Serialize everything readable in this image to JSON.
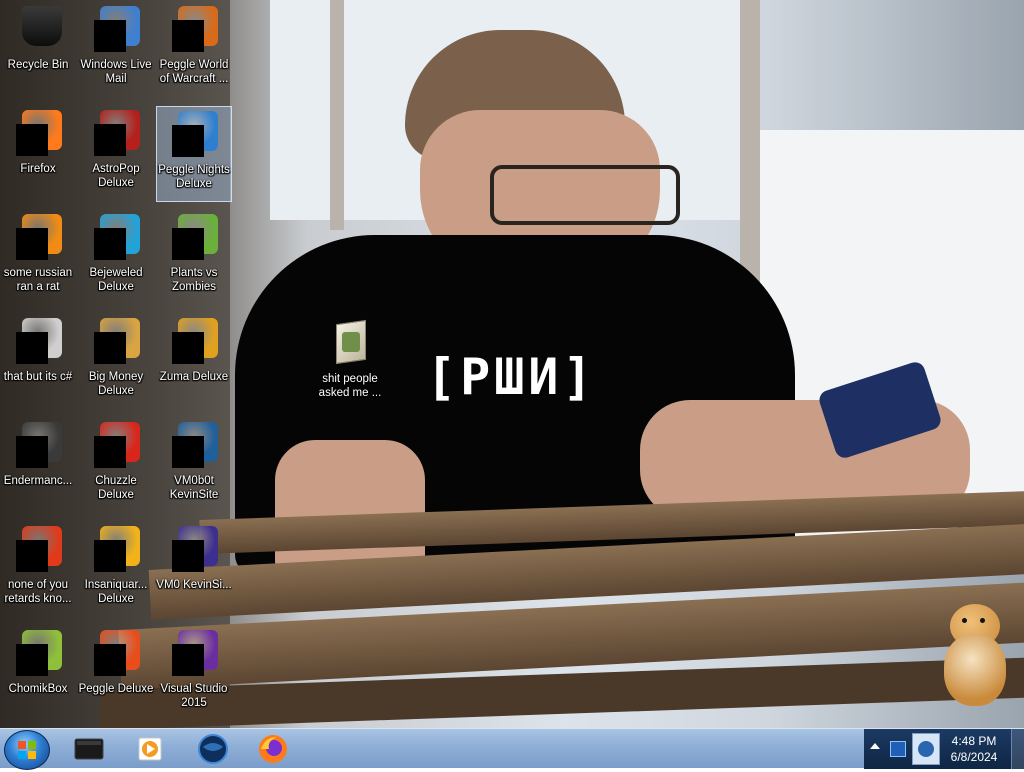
{
  "desktop": {
    "icons": [
      {
        "id": "recycle-bin",
        "label": "Recycle Bin",
        "icon": "recycle-bin-icon",
        "color": "#1b1b1b"
      },
      {
        "id": "windows-live-mail",
        "label": "Windows Live Mail",
        "icon": "mail-icon",
        "color": "#3f7fd0"
      },
      {
        "id": "peggle-world-of-warcraft",
        "label": "Peggle World of Warcraft ...",
        "icon": "peggle-wow-icon",
        "color": "#d76b1a"
      },
      {
        "id": "firefox",
        "label": "Firefox",
        "icon": "firefox-icon",
        "color": "#ff7a1a"
      },
      {
        "id": "astropop-deluxe",
        "label": "AstroPop Deluxe",
        "icon": "astropop-icon",
        "color": "#b4201c"
      },
      {
        "id": "peggle-nights-deluxe",
        "label": "Peggle Nights Deluxe",
        "icon": "peggle-nights-icon",
        "color": "#2e7fcf"
      },
      {
        "id": "some-russian-ran-a-rat",
        "label": "some russian ran a rat",
        "icon": "orange-file-icon",
        "color": "#f08c14"
      },
      {
        "id": "bejeweled-deluxe",
        "label": "Bejeweled Deluxe",
        "icon": "bejeweled-icon",
        "color": "#23a2d8"
      },
      {
        "id": "plants-vs-zombies",
        "label": "Plants vs Zombies",
        "icon": "plants-vs-zombies-icon",
        "color": "#6ab03a"
      },
      {
        "id": "that-but-its-csharp",
        "label": "that but its c#",
        "icon": "documents-icon",
        "color": "#cfcfcf"
      },
      {
        "id": "big-money-deluxe",
        "label": "Big Money Deluxe",
        "icon": "big-money-icon",
        "color": "#d9a441"
      },
      {
        "id": "zuma-deluxe",
        "label": "Zuma Deluxe",
        "icon": "zuma-icon",
        "color": "#e0a020"
      },
      {
        "id": "endermanch",
        "label": "Endermanc...",
        "icon": "window-app-icon",
        "color": "#3a3a3a"
      },
      {
        "id": "chuzzle-deluxe",
        "label": "Chuzzle Deluxe",
        "icon": "chuzzle-icon",
        "color": "#d9261c"
      },
      {
        "id": "vm0b0t-kevinsite",
        "label": "VM0b0t KevinSite",
        "icon": "vm0b0t-icon",
        "color": "#1f5f9a"
      },
      {
        "id": "none-of-you-retards",
        "label": "none of you retards kno...",
        "icon": "peggle-ball-icon",
        "color": "#e03a1a"
      },
      {
        "id": "insaniquarium-deluxe",
        "label": "Insaniquar... Deluxe",
        "icon": "insaniquarium-icon",
        "color": "#f1b21a"
      },
      {
        "id": "vm0-kevinsi",
        "label": "VM0 KevinSi...",
        "icon": "vm0-icon",
        "color": "#3c2f8f"
      },
      {
        "id": "chomikbox",
        "label": "ChomikBox",
        "icon": "chomikbox-icon",
        "color": "#8ec03a"
      },
      {
        "id": "peggle-deluxe",
        "label": "Peggle Deluxe",
        "icon": "peggle-icon",
        "color": "#e84d1c"
      },
      {
        "id": "visual-studio-2015",
        "label": "Visual Studio 2015",
        "icon": "visual-studio-icon",
        "color": "#6a2ea0"
      }
    ],
    "center_icon": {
      "label": "shit people asked me ...",
      "icon": "folder-icon",
      "color": "#d9d2b8"
    },
    "shirt_text": "[РШИ]"
  },
  "taskbar": {
    "start_icon": "windows-start-icon",
    "pinned": [
      {
        "id": "black-app",
        "icon": "black-window-icon",
        "color": "#1a1a1a"
      },
      {
        "id": "media-player",
        "icon": "media-player-icon",
        "color": "#f39c1f"
      },
      {
        "id": "globe-app",
        "icon": "globe-icon",
        "color": "#1c4d8a"
      },
      {
        "id": "firefox-pinned",
        "icon": "firefox-icon",
        "color": "#ff7a1a"
      }
    ],
    "tray": {
      "expand_icon": "tray-up-arrow-icon",
      "network_icon": "network-icon",
      "app_icon": "tray-app-icon"
    },
    "clock": {
      "time": "4:48 PM",
      "date": "6/8/2024"
    }
  },
  "mascot": {
    "icon": "hamster-icon",
    "color": "#c98a3b"
  }
}
